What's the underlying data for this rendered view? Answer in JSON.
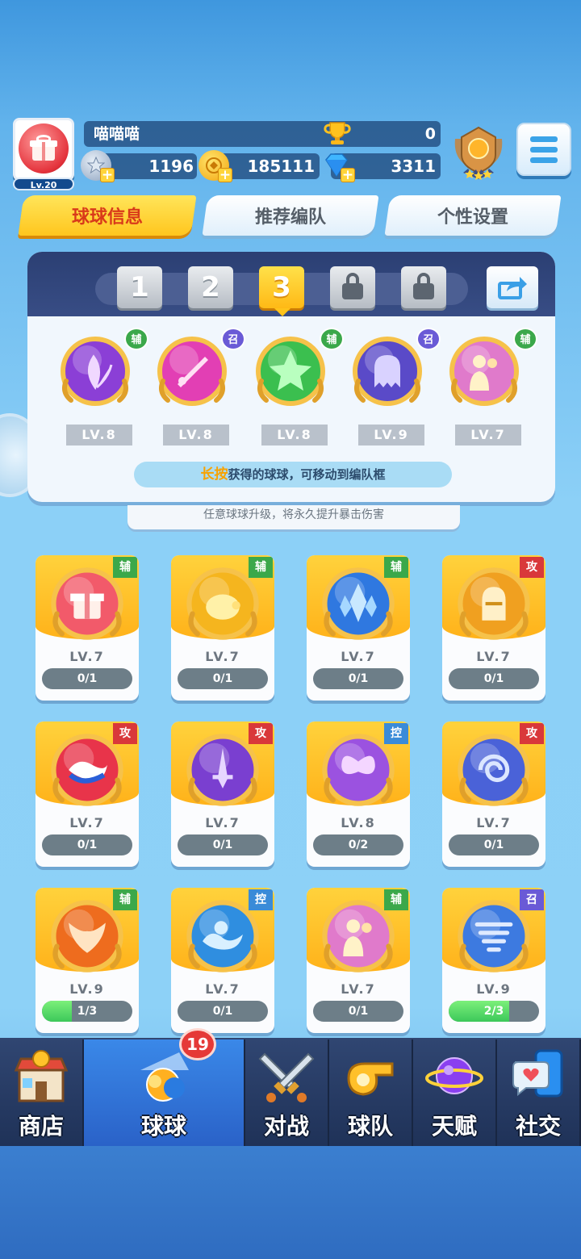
{
  "player": {
    "name": "喵喵喵",
    "level": "Lv.20",
    "trophies": "0",
    "stars": "1196",
    "coins": "185111",
    "gems": "3311"
  },
  "tabs": [
    {
      "label": "球球信息",
      "active": true
    },
    {
      "label": "推荐编队",
      "active": false
    },
    {
      "label": "个性设置",
      "active": false
    }
  ],
  "team": {
    "slots": [
      {
        "label": "1",
        "state": "available"
      },
      {
        "label": "2",
        "state": "available"
      },
      {
        "label": "3",
        "state": "selected"
      },
      {
        "label": "",
        "state": "locked"
      },
      {
        "label": "",
        "state": "locked"
      }
    ],
    "balls": [
      {
        "tag": "辅",
        "level": "LV.8",
        "color": "#8b3fd6",
        "icon": "leaf-icon"
      },
      {
        "tag": "召",
        "level": "LV.8",
        "color": "#e23fb4",
        "icon": "sword-icon"
      },
      {
        "tag": "辅",
        "level": "LV.8",
        "color": "#3bbf4f",
        "icon": "star-arrow-icon"
      },
      {
        "tag": "召",
        "level": "LV.9",
        "color": "#5a4ac8",
        "icon": "ghost-icon"
      },
      {
        "tag": "辅",
        "level": "LV.7",
        "color": "#e07acb",
        "icon": "silhouette-icon"
      }
    ],
    "hint_highlight": "长按",
    "hint_rest": "获得的球球，可移动到编队框"
  },
  "tip": "任意球球升级，将永久提升暴击伤害",
  "collection": [
    {
      "tag": "辅",
      "tag_color": "#3ba84a",
      "level": "LV.7",
      "progress": "0/1",
      "fill": 0,
      "color": "#f25a6a",
      "icon": "gift-icon"
    },
    {
      "tag": "辅",
      "tag_color": "#3ba84a",
      "level": "LV.7",
      "progress": "0/1",
      "fill": 0,
      "color": "#f5b51e",
      "icon": "piggy-bank-icon"
    },
    {
      "tag": "辅",
      "tag_color": "#3ba84a",
      "level": "LV.7",
      "progress": "0/1",
      "fill": 0,
      "color": "#2f78e0",
      "icon": "crystal-icon"
    },
    {
      "tag": "攻",
      "tag_color": "#d9383a",
      "level": "LV.7",
      "progress": "0/1",
      "fill": 0,
      "color": "#f0a020",
      "icon": "knight-helmet-icon"
    },
    {
      "tag": "攻",
      "tag_color": "#d9383a",
      "level": "LV.7",
      "progress": "0/1",
      "fill": 0,
      "color": "#e8344a",
      "icon": "taiji-icon"
    },
    {
      "tag": "攻",
      "tag_color": "#d9383a",
      "level": "LV.7",
      "progress": "0/1",
      "fill": 0,
      "color": "#7a3fd0",
      "icon": "dagger-icon"
    },
    {
      "tag": "控",
      "tag_color": "#3a8bd8",
      "level": "LV.8",
      "progress": "0/2",
      "fill": 0,
      "color": "#9b52e0",
      "icon": "butterfly-icon"
    },
    {
      "tag": "攻",
      "tag_color": "#d9383a",
      "level": "LV.7",
      "progress": "0/1",
      "fill": 0,
      "color": "#4a62d8",
      "icon": "vortex-icon"
    },
    {
      "tag": "辅",
      "tag_color": "#3ba84a",
      "level": "LV.9",
      "progress": "1/3",
      "fill": 0.333,
      "color": "#ee6c1e",
      "icon": "phoenix-icon"
    },
    {
      "tag": "控",
      "tag_color": "#3a8bd8",
      "level": "LV.7",
      "progress": "0/1",
      "fill": 0,
      "color": "#2f8ee0",
      "icon": "wave-icon"
    },
    {
      "tag": "辅",
      "tag_color": "#3ba84a",
      "level": "LV.7",
      "progress": "0/1",
      "fill": 0,
      "color": "#e07acb",
      "icon": "silhouette-icon"
    },
    {
      "tag": "召",
      "tag_color": "#6a5ad6",
      "level": "LV.9",
      "progress": "2/3",
      "fill": 0.667,
      "color": "#3d7ae0",
      "icon": "tornado-icon"
    }
  ],
  "nav": [
    {
      "label": "商店",
      "icon": "shop-icon",
      "active": false
    },
    {
      "label": "球球",
      "icon": "balls-icon",
      "active": true,
      "badge": "19"
    },
    {
      "label": "对战",
      "icon": "crossed-swords-icon",
      "active": false
    },
    {
      "label": "球队",
      "icon": "whistle-icon",
      "active": false
    },
    {
      "label": "天赋",
      "icon": "planet-icon",
      "active": false
    },
    {
      "label": "社交",
      "icon": "chat-phone-icon",
      "active": false
    }
  ]
}
